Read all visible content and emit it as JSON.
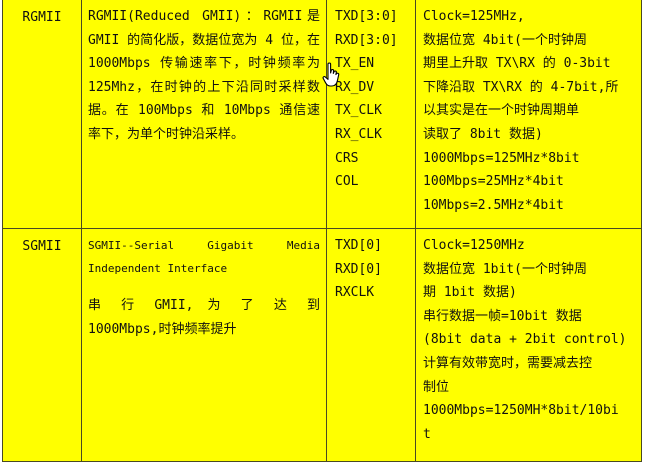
{
  "rows": [
    {
      "name": "RGMII",
      "description": "RGMII(Reduced GMII)：RGMII是 GMII 的简化版，数据位宽为 4 位，在 1000Mbps 传输速率下，时钟频率为 125Mhz，在时钟的上下沿同时采样数据。在 100Mbps 和 10Mbps 通信速率下，为单个时钟沿采样。",
      "signals": [
        "TXD[3:0]",
        "RXD[3:0]",
        "TX_EN",
        "RX_DV",
        "TX_CLK",
        "RX_CLK",
        "CRS",
        "COL"
      ],
      "notes": [
        "Clock=125MHz,",
        "数据位宽 4bit(一个时钟周",
        "期里上升取 TX\\RX 的 0-3bit",
        "下降沿取 TX\\RX 的 4-7bit,所",
        "以其实是在一个时钟周期单",
        "读取了 8bit 数据)",
        "1000Mbps=125MHz*8bit",
        "100Mbps=25MHz*4bit",
        "10Mbps=2.5MHz*4bit"
      ]
    },
    {
      "name": "SGMII",
      "description_en": "SGMII--Serial Gigabit Media Independent Interface",
      "description": "串 行 GMII, 为 了 达 到 1000Mbps,时钟频率提升",
      "signals": [
        "TXD[0]",
        "RXD[0]",
        "RXCLK"
      ],
      "notes": [
        "Clock=1250MHz",
        "数据位宽 1bit(一个时钟周",
        "期 1bit 数据)",
        "串行数据一帧=10bit 数据",
        "(8bit data + 2bit control)",
        "计算有效带宽时，需要减去控",
        "制位",
        "1000Mbps=1250MH*8bit/10bi",
        "t"
      ]
    }
  ],
  "cursor_icon": "hand-pointer-icon"
}
